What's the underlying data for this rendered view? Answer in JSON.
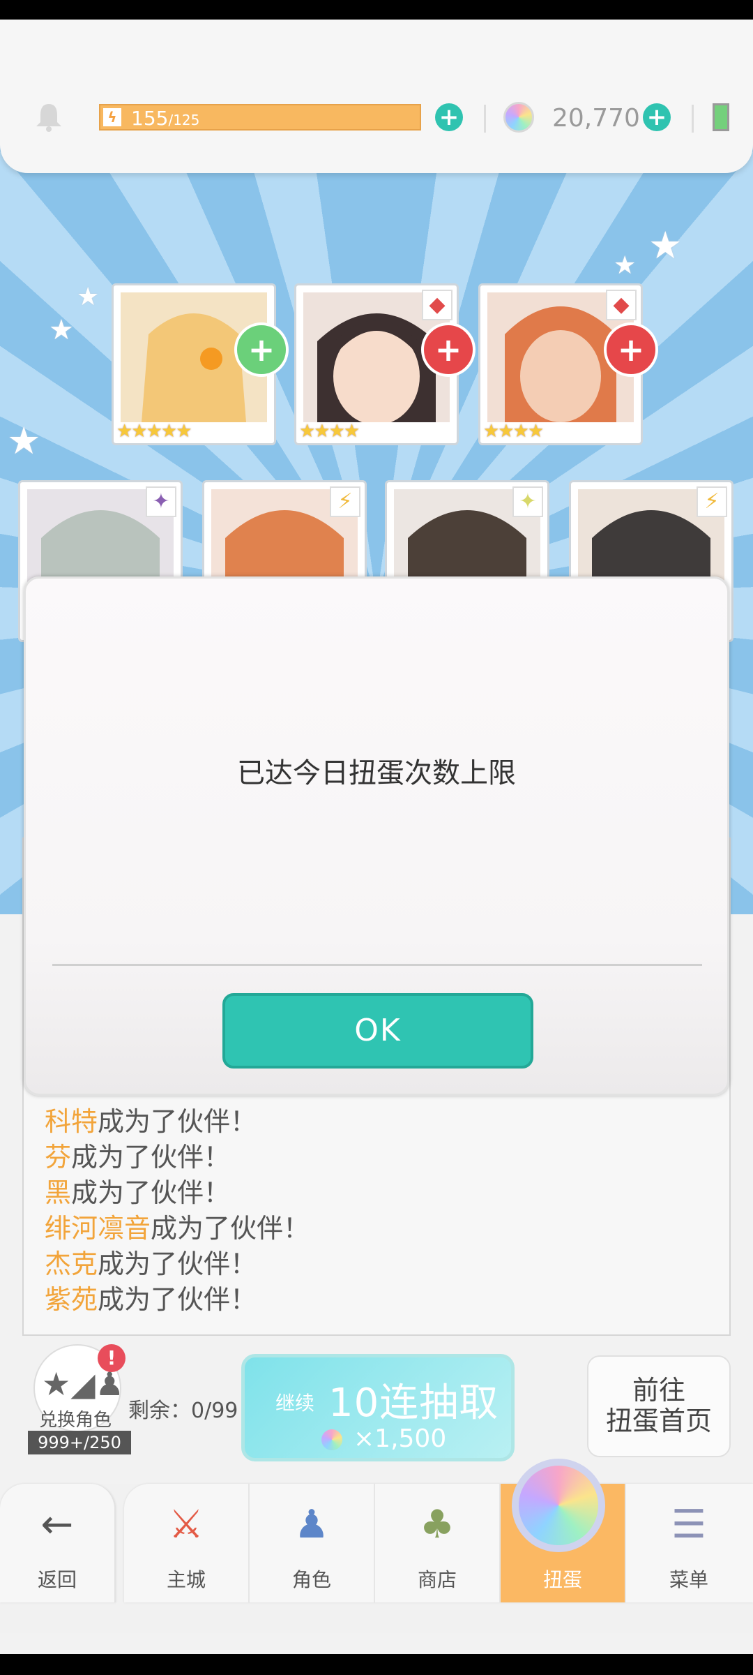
{
  "header": {
    "stamina_current": "155",
    "stamina_max": "/125",
    "gems": "20,770"
  },
  "cards_row1": [
    {
      "stars": "★★★★★"
    },
    {
      "stars": "★★★★"
    },
    {
      "stars": "★★★★"
    }
  ],
  "dialog": {
    "message": "已达今日扭蛋次数上限",
    "ok_label": "OK"
  },
  "results": [
    {
      "name": "科特",
      "text": "成为了伙伴！"
    },
    {
      "name": "芬",
      "text": "成为了伙伴！"
    },
    {
      "name": "黑",
      "text": "成为了伙伴！"
    },
    {
      "name": "绯河凛音",
      "text": "成为了伙伴！"
    },
    {
      "name": "杰克",
      "text": "成为了伙伴！"
    },
    {
      "name": "紫苑",
      "text": "成为了伙伴！"
    }
  ],
  "exchange": {
    "label": "兑换角色",
    "count": "999+/250",
    "alert": "!"
  },
  "remaining": "剩余：0/99",
  "pull10": {
    "continue": "继续",
    "label": "10连抽取",
    "cost": "×1,500"
  },
  "goto": {
    "line1": "前往",
    "line2": "扭蛋首页"
  },
  "nav": {
    "back": "返回",
    "items": [
      "主城",
      "角色",
      "商店",
      "扭蛋",
      "菜单"
    ]
  },
  "colors": {
    "accent_teal": "#2fc4b2",
    "accent_orange": "#f8b860",
    "name_orange": "#f2a43a"
  }
}
